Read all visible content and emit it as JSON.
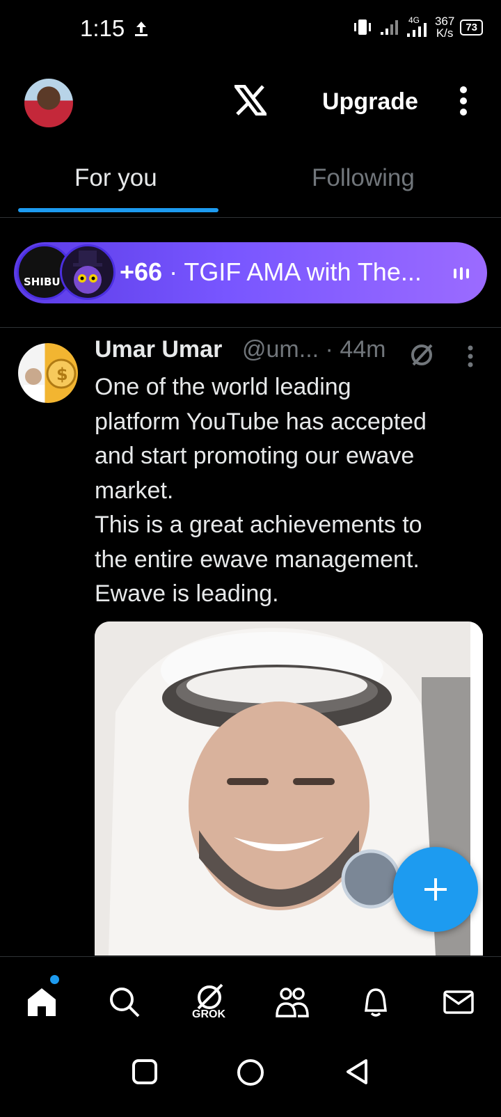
{
  "status_bar": {
    "time": "1:15",
    "network_type": "4G",
    "speed_value": "367",
    "speed_unit": "K/s",
    "battery": "73"
  },
  "header": {
    "logo": "x-logo-icon",
    "upgrade_label": "Upgrade"
  },
  "tabs": [
    {
      "label": "For you",
      "active": true
    },
    {
      "label": "Following",
      "active": false
    }
  ],
  "spaces": {
    "avatar1_text": "SHIBU",
    "listener_count": "+66",
    "title": " · TGIF AMA with The..."
  },
  "tweet": {
    "name": "Umar Umar",
    "handle": "@um...",
    "time": "· 44m",
    "body_lines": [
      "One of the world leading",
      "platform YouTube has accepted",
      "and  start promoting our ewave",
      "market.",
      "This is a great achievements to",
      "the entire ewave management.",
      "Ewave is leading."
    ]
  },
  "bottom_nav": {
    "items": [
      "home-icon",
      "search-icon",
      "grok-icon",
      "communities-icon",
      "notifications-icon",
      "messages-icon"
    ],
    "grok_label": "GROK"
  },
  "colors": {
    "accent": "#1d9bf0",
    "background": "#000000",
    "text_primary": "#e7e9ea",
    "text_secondary": "#71767b",
    "spaces_purple": "#7856ff"
  }
}
